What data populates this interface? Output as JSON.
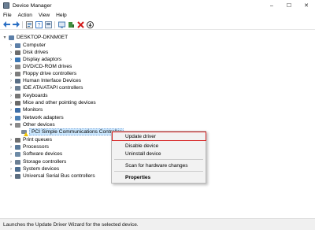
{
  "window": {
    "title": "Device Manager",
    "controls": [
      "–",
      "☐",
      "✕"
    ]
  },
  "menu": {
    "items": [
      "File",
      "Action",
      "View",
      "Help"
    ]
  },
  "toolbar": {
    "buttons": [
      "back-icon",
      "forward-icon",
      "properties-icon",
      "help-icon",
      "show-hidden-icon",
      "scan-icon",
      "update-driver-icon",
      "disable-icon",
      "uninstall-icon",
      "download-icon"
    ]
  },
  "tree": {
    "root": "DESKTOP-DKNM0ET",
    "items": [
      {
        "label": "Computer",
        "color": "#5c7fa8"
      },
      {
        "label": "Disk drives",
        "color": "#6d6d6d"
      },
      {
        "label": "Display adaptors",
        "color": "#3b78b6"
      },
      {
        "label": "DVD/CD-ROM drives",
        "color": "#888888"
      },
      {
        "label": "Floppy drive controllers",
        "color": "#7d7d7d"
      },
      {
        "label": "Human Interface Devices",
        "color": "#5a6f86"
      },
      {
        "label": "IDE ATA/ATAPI controllers",
        "color": "#6b7f94"
      },
      {
        "label": "Keyboards",
        "color": "#777777"
      },
      {
        "label": "Mice and other pointing devices",
        "color": "#6a6a6a"
      },
      {
        "label": "Monitors",
        "color": "#3f6fa8"
      },
      {
        "label": "Network adapters",
        "color": "#4a7fb5"
      },
      {
        "label": "Other devices",
        "color": "#8a8a8a"
      },
      {
        "label": "PCI Simple Communications Controller",
        "color": "#7d8a99"
      },
      {
        "label": "Print queues",
        "color": "#6f6f6f"
      },
      {
        "label": "Processors",
        "color": "#5a7a9a"
      },
      {
        "label": "Software devices",
        "color": "#6d8aa6"
      },
      {
        "label": "Storage controllers",
        "color": "#6b7f94"
      },
      {
        "label": "System devices",
        "color": "#4e6f92"
      },
      {
        "label": "Universal Serial Bus controllers",
        "color": "#5d6f82"
      }
    ]
  },
  "context_menu": {
    "update_driver": "Update driver",
    "disable_device": "Disable device",
    "uninstall_device": "Uninstall device",
    "scan": "Scan for hardware changes",
    "properties": "Properties"
  },
  "status": {
    "text": "Launches the Update Driver Wizard for the selected device."
  },
  "colors": {
    "selection": "#cce8ff",
    "highlight_border": "#d61f1f",
    "warning": "#f2c400"
  }
}
